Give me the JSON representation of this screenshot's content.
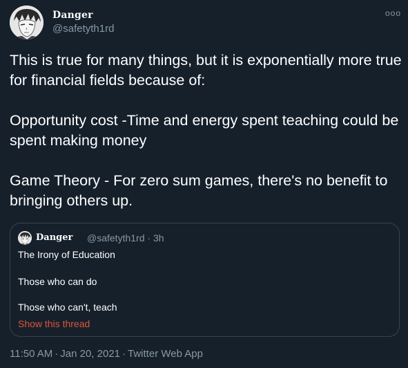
{
  "tweet": {
    "author": {
      "display_name": "Danger",
      "handle": "@safetyth1rd",
      "avatar_icon": "manga-avatar"
    },
    "more_icon": "more-horizontal-icon",
    "more_label": "ooo",
    "paragraphs": [
      "This is true for many things, but it is exponentially more true for financial fields because of:",
      "Opportunity cost -Time and energy spent teaching could be spent making money",
      "Game Theory - For zero sum games, there's no benefit to bringing others up."
    ],
    "quoted": {
      "display_name": "Danger",
      "handle": "@safetyth1rd",
      "separator": "·",
      "age": "3h",
      "lines": [
        "The Irony of Education",
        "Those who can do",
        "Those who can't, teach"
      ],
      "show_thread": "Show this thread"
    },
    "footer": {
      "time": "11:50 AM",
      "separator": "·",
      "date": "Jan 20, 2021",
      "source": "Twitter Web App"
    }
  },
  "colors": {
    "background": "#15202b",
    "text": "#ffffff",
    "secondary": "#8899a6",
    "border": "#38444d",
    "link": "#e0533a"
  }
}
